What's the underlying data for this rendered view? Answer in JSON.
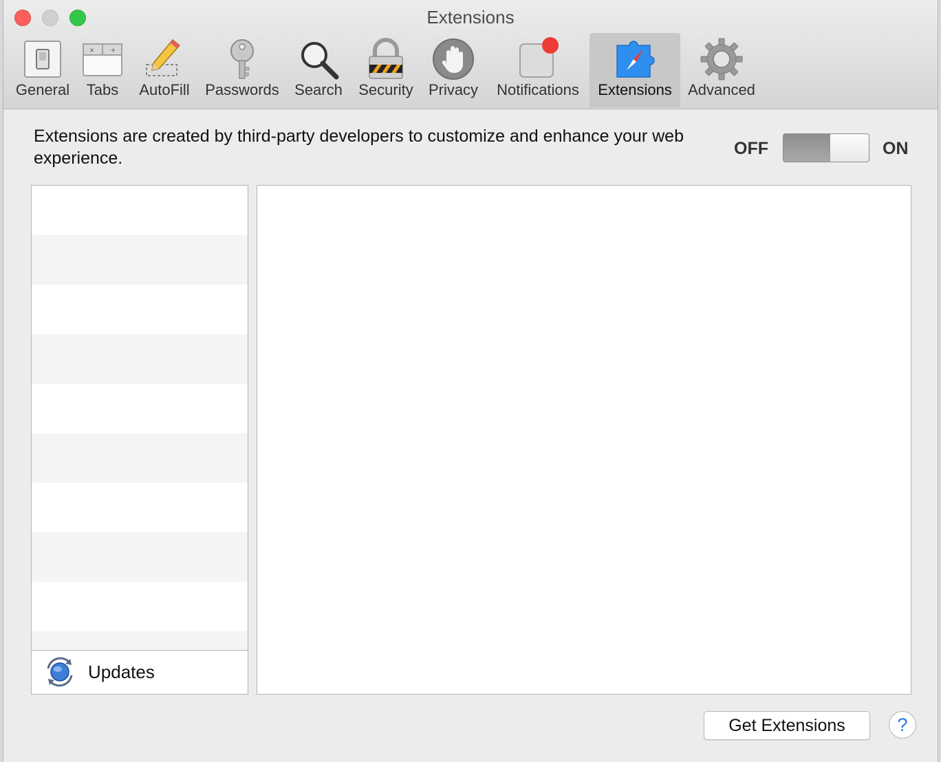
{
  "window": {
    "title": "Extensions"
  },
  "toolbar": {
    "items": [
      {
        "label": "General",
        "icon": "general-switch-icon"
      },
      {
        "label": "Tabs",
        "icon": "tabs-icon"
      },
      {
        "label": "AutoFill",
        "icon": "pencil-icon"
      },
      {
        "label": "Passwords",
        "icon": "key-icon"
      },
      {
        "label": "Search",
        "icon": "magnifier-icon"
      },
      {
        "label": "Security",
        "icon": "padlock-icon"
      },
      {
        "label": "Privacy",
        "icon": "hand-icon"
      },
      {
        "label": "Notifications",
        "icon": "notification-badge-icon"
      },
      {
        "label": "Extensions",
        "icon": "puzzle-compass-icon",
        "selected": true
      },
      {
        "label": "Advanced",
        "icon": "gear-icon"
      }
    ]
  },
  "main": {
    "description": "Extensions are created by third-party developers to customize and enhance your web experience.",
    "toggle": {
      "off_label": "OFF",
      "on_label": "ON",
      "state": "on"
    },
    "list": {
      "updates_label": "Updates"
    },
    "get_extensions_label": "Get Extensions",
    "help_label": "?"
  },
  "colors": {
    "close": "#fc605c",
    "minimize": "#d0d0d0",
    "zoom": "#34c84a",
    "selected_tab": "#c8c8c8",
    "accent_blue": "#2b7ae5"
  }
}
